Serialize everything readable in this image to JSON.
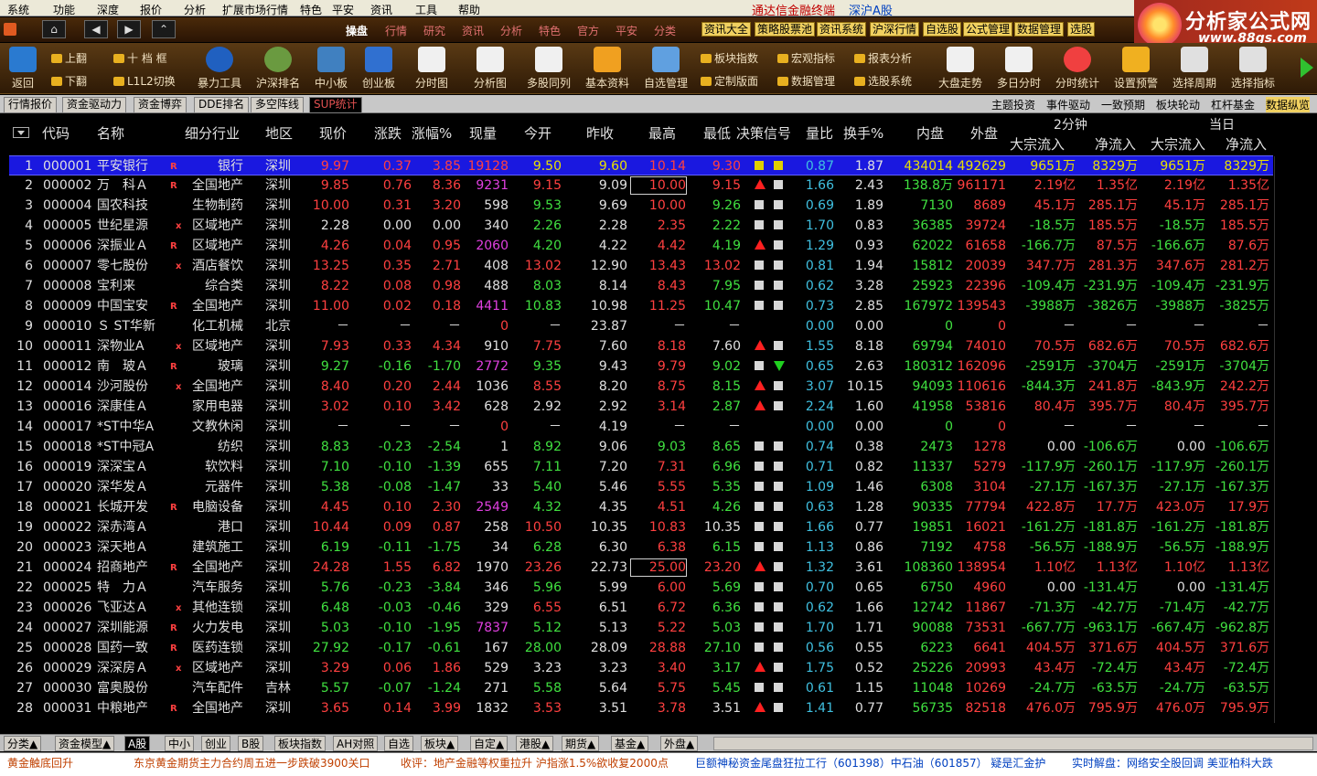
{
  "menu": [
    "系统",
    "功能",
    "深度",
    "报价",
    "分析",
    "扩展市场行情",
    "特色",
    "平安",
    "资讯",
    "工具",
    "帮助"
  ],
  "app_title": "通达信金融终端",
  "app_subtitle": "深沪A股",
  "logo": {
    "name": "分析家公式网",
    "url": "www.88gs.com"
  },
  "nav": {
    "back": "◀",
    "forward": "▶",
    "up": "⌃",
    "home": "⌂"
  },
  "tabs2": [
    "操盘",
    "行情",
    "研究",
    "资讯",
    "分析",
    "特色",
    "官方",
    "平安",
    "分类"
  ],
  "yellow_btns": [
    "资讯大全",
    "策略股票池",
    "资讯系统",
    "沪深行情",
    "自选股",
    "公式管理",
    "数据管理",
    "选股"
  ],
  "toolbar": {
    "back": "返回",
    "up": "上翻",
    "down": "下翻",
    "f10": "十 档 框",
    "l1l2": "L1L2切换",
    "tools": "暴力工具",
    "hs_rank": "沪深排名",
    "small": "中小板",
    "gem": "创业板",
    "timechart": "分时图",
    "analysis": "分析图",
    "multi": "多股同列",
    "basic": "基本资料",
    "custom": "自选管理",
    "sector": "板块指数",
    "macro": "宏观指标",
    "report": "报表分析",
    "layout": "定制版面",
    "datamgr": "数据管理",
    "selsys": "选股系统",
    "trend": "大盘走势",
    "multiday": "多日分时",
    "timestat": "分时统计",
    "alert": "设置预警",
    "period": "选择周期",
    "indicator": "选择指标"
  },
  "tabs": [
    "行情报价",
    "资金驱动力",
    "资金博弈",
    "DDE排名",
    "多空阵线",
    "SUP统计"
  ],
  "right_tabs": [
    "主题投资",
    "事件驱动",
    "一致预期",
    "板块轮动",
    "杠杆基金",
    "数据纵览"
  ],
  "headers": {
    "code": "代码",
    "name": "名称",
    "industry": "细分行业",
    "region": "地区",
    "price": "现价",
    "change": "涨跌",
    "pct": "涨幅%",
    "vol": "现量",
    "open": "今开",
    "prev": "昨收",
    "high": "最高",
    "low": "最低",
    "signal": "决策信号",
    "ratio": "量比",
    "turnover": "换手%",
    "inner": "内盘",
    "outer": "外盘",
    "group1": "2分钟",
    "group2": "当日",
    "bigin": "大宗流入",
    "netin": "净流入"
  },
  "rows": [
    [
      "1",
      "000001",
      "平安银行",
      "R",
      "银行",
      "深圳",
      "9.97",
      "0.37",
      "3.85",
      "19128",
      "9.50",
      "9.60",
      "10.14",
      "9.30",
      "yy",
      "0.87",
      "1.87",
      "434014",
      "492629",
      "9651万",
      "8329万",
      "9651万",
      "8329万"
    ],
    [
      "2",
      "000002",
      "万　科Ａ",
      "R",
      "全国地产",
      "深圳",
      "9.85",
      "0.76",
      "8.36",
      "9231",
      "9.15",
      "9.09",
      "10.00",
      "9.15",
      "us",
      "1.66",
      "2.43",
      "138.8万",
      "961171",
      "2.19亿",
      "1.35亿",
      "2.19亿",
      "1.35亿"
    ],
    [
      "3",
      "000004",
      "国农科技",
      "",
      "生物制药",
      "深圳",
      "10.00",
      "0.31",
      "3.20",
      "598",
      "9.53",
      "9.69",
      "10.00",
      "9.26",
      "ss",
      "0.69",
      "1.89",
      "7130",
      "8689",
      "45.1万",
      "285.1万",
      "45.1万",
      "285.1万"
    ],
    [
      "4",
      "000005",
      "世纪星源",
      "x",
      "区域地产",
      "深圳",
      "2.28",
      "0.00",
      "0.00",
      "340",
      "2.26",
      "2.28",
      "2.35",
      "2.22",
      "ss",
      "1.70",
      "0.83",
      "36385",
      "39724",
      "-18.5万",
      "185.5万",
      "-18.5万",
      "185.5万"
    ],
    [
      "5",
      "000006",
      "深振业Ａ",
      "R",
      "区域地产",
      "深圳",
      "4.26",
      "0.04",
      "0.95",
      "2060",
      "4.20",
      "4.22",
      "4.42",
      "4.19",
      "us",
      "1.29",
      "0.93",
      "62022",
      "61658",
      "-166.7万",
      "87.5万",
      "-166.6万",
      "87.6万"
    ],
    [
      "6",
      "000007",
      "零七股份",
      "x",
      "酒店餐饮",
      "深圳",
      "13.25",
      "0.35",
      "2.71",
      "408",
      "13.02",
      "12.90",
      "13.43",
      "13.02",
      "ss",
      "0.81",
      "1.94",
      "15812",
      "20039",
      "347.7万",
      "281.3万",
      "347.6万",
      "281.2万"
    ],
    [
      "7",
      "000008",
      "宝利来",
      "",
      "综合类",
      "深圳",
      "8.22",
      "0.08",
      "0.98",
      "488",
      "8.03",
      "8.14",
      "8.43",
      "7.95",
      "ss",
      "0.62",
      "3.28",
      "25923",
      "22396",
      "-109.4万",
      "-231.9万",
      "-109.4万",
      "-231.9万"
    ],
    [
      "8",
      "000009",
      "中国宝安",
      "R",
      "全国地产",
      "深圳",
      "11.00",
      "0.02",
      "0.18",
      "4411",
      "10.83",
      "10.98",
      "11.25",
      "10.47",
      "ss",
      "0.73",
      "2.85",
      "167972",
      "139543",
      "-3988万",
      "-3826万",
      "-3988万",
      "-3825万"
    ],
    [
      "9",
      "000010",
      "Ｓ ST华新",
      "",
      "化工机械",
      "北京",
      "－",
      "－",
      "－",
      "0",
      "－",
      "23.87",
      "－",
      "－",
      "",
      "0.00",
      "0.00",
      "0",
      "0",
      "－",
      "－",
      "－",
      "－"
    ],
    [
      "10",
      "000011",
      "深物业A",
      "x",
      "区域地产",
      "深圳",
      "7.93",
      "0.33",
      "4.34",
      "910",
      "7.75",
      "7.60",
      "8.18",
      "7.60",
      "us",
      "1.55",
      "8.18",
      "69794",
      "74010",
      "70.5万",
      "682.6万",
      "70.5万",
      "682.6万"
    ],
    [
      "11",
      "000012",
      "南　玻Ａ",
      "R",
      "玻璃",
      "深圳",
      "9.27",
      "-0.16",
      "-1.70",
      "2772",
      "9.35",
      "9.43",
      "9.79",
      "9.02",
      "sd",
      "0.65",
      "2.63",
      "180312",
      "162096",
      "-2591万",
      "-3704万",
      "-2591万",
      "-3704万"
    ],
    [
      "12",
      "000014",
      "沙河股份",
      "x",
      "全国地产",
      "深圳",
      "8.40",
      "0.20",
      "2.44",
      "1036",
      "8.55",
      "8.20",
      "8.75",
      "8.15",
      "us",
      "3.07",
      "10.15",
      "94093",
      "110616",
      "-844.3万",
      "241.8万",
      "-843.9万",
      "242.2万"
    ],
    [
      "13",
      "000016",
      "深康佳Ａ",
      "",
      "家用电器",
      "深圳",
      "3.02",
      "0.10",
      "3.42",
      "628",
      "2.92",
      "2.92",
      "3.14",
      "2.87",
      "us",
      "2.24",
      "1.60",
      "41958",
      "53816",
      "80.4万",
      "395.7万",
      "80.4万",
      "395.7万"
    ],
    [
      "14",
      "000017",
      "*ST中华A",
      "",
      "文教休闲",
      "深圳",
      "－",
      "－",
      "－",
      "0",
      "－",
      "4.19",
      "－",
      "－",
      "",
      "0.00",
      "0.00",
      "0",
      "0",
      "－",
      "－",
      "－",
      "－"
    ],
    [
      "15",
      "000018",
      "*ST中冠A",
      "",
      "纺织",
      "深圳",
      "8.83",
      "-0.23",
      "-2.54",
      "1",
      "8.92",
      "9.06",
      "9.03",
      "8.65",
      "ss",
      "0.74",
      "0.38",
      "2473",
      "1278",
      "0.00",
      "-106.6万",
      "0.00",
      "-106.6万"
    ],
    [
      "16",
      "000019",
      "深深宝Ａ",
      "",
      "软饮料",
      "深圳",
      "7.10",
      "-0.10",
      "-1.39",
      "655",
      "7.11",
      "7.20",
      "7.31",
      "6.96",
      "ss",
      "0.71",
      "0.82",
      "11337",
      "5279",
      "-117.9万",
      "-260.1万",
      "-117.9万",
      "-260.1万"
    ],
    [
      "17",
      "000020",
      "深华发Ａ",
      "",
      "元器件",
      "深圳",
      "5.38",
      "-0.08",
      "-1.47",
      "33",
      "5.40",
      "5.46",
      "5.55",
      "5.35",
      "ss",
      "1.09",
      "1.46",
      "6308",
      "3104",
      "-27.1万",
      "-167.3万",
      "-27.1万",
      "-167.3万"
    ],
    [
      "18",
      "000021",
      "长城开发",
      "R",
      "电脑设备",
      "深圳",
      "4.45",
      "0.10",
      "2.30",
      "2549",
      "4.32",
      "4.35",
      "4.51",
      "4.26",
      "ss",
      "0.63",
      "1.28",
      "90335",
      "77794",
      "422.8万",
      "17.7万",
      "423.0万",
      "17.9万"
    ],
    [
      "19",
      "000022",
      "深赤湾Ａ",
      "",
      "港口",
      "深圳",
      "10.44",
      "0.09",
      "0.87",
      "258",
      "10.50",
      "10.35",
      "10.83",
      "10.35",
      "ss",
      "1.66",
      "0.77",
      "19851",
      "16021",
      "-161.2万",
      "-181.8万",
      "-161.2万",
      "-181.8万"
    ],
    [
      "20",
      "000023",
      "深天地Ａ",
      "",
      "建筑施工",
      "深圳",
      "6.19",
      "-0.11",
      "-1.75",
      "34",
      "6.28",
      "6.30",
      "6.38",
      "6.15",
      "ss",
      "1.13",
      "0.86",
      "7192",
      "4758",
      "-56.5万",
      "-188.9万",
      "-56.5万",
      "-188.9万"
    ],
    [
      "21",
      "000024",
      "招商地产",
      "R",
      "全国地产",
      "深圳",
      "24.28",
      "1.55",
      "6.82",
      "1970",
      "23.26",
      "22.73",
      "25.00",
      "23.20",
      "us",
      "1.32",
      "3.61",
      "108360",
      "138954",
      "1.10亿",
      "1.13亿",
      "1.10亿",
      "1.13亿"
    ],
    [
      "22",
      "000025",
      "特　力Ａ",
      "",
      "汽车服务",
      "深圳",
      "5.76",
      "-0.23",
      "-3.84",
      "346",
      "5.96",
      "5.99",
      "6.00",
      "5.69",
      "ss",
      "0.70",
      "0.65",
      "6750",
      "4960",
      "0.00",
      "-131.4万",
      "0.00",
      "-131.4万"
    ],
    [
      "23",
      "000026",
      "飞亚达Ａ",
      "x",
      "其他连锁",
      "深圳",
      "6.48",
      "-0.03",
      "-0.46",
      "329",
      "6.55",
      "6.51",
      "6.72",
      "6.36",
      "ss",
      "0.62",
      "1.66",
      "12742",
      "11867",
      "-71.3万",
      "-42.7万",
      "-71.4万",
      "-42.7万"
    ],
    [
      "24",
      "000027",
      "深圳能源",
      "R",
      "火力发电",
      "深圳",
      "5.03",
      "-0.10",
      "-1.95",
      "7837",
      "5.12",
      "5.13",
      "5.22",
      "5.03",
      "ss",
      "1.70",
      "1.71",
      "90088",
      "73531",
      "-667.7万",
      "-963.1万",
      "-667.4万",
      "-962.8万"
    ],
    [
      "25",
      "000028",
      "国药一致",
      "R",
      "医药连锁",
      "深圳",
      "27.92",
      "-0.17",
      "-0.61",
      "167",
      "28.00",
      "28.09",
      "28.88",
      "27.10",
      "ss",
      "0.56",
      "0.55",
      "6223",
      "6641",
      "404.5万",
      "371.6万",
      "404.5万",
      "371.6万"
    ],
    [
      "26",
      "000029",
      "深深房Ａ",
      "x",
      "区域地产",
      "深圳",
      "3.29",
      "0.06",
      "1.86",
      "529",
      "3.23",
      "3.23",
      "3.40",
      "3.17",
      "us",
      "1.75",
      "0.52",
      "25226",
      "20993",
      "43.4万",
      "-72.4万",
      "43.4万",
      "-72.4万"
    ],
    [
      "27",
      "000030",
      "富奥股份",
      "",
      "汽车配件",
      "吉林",
      "5.57",
      "-0.07",
      "-1.24",
      "271",
      "5.58",
      "5.64",
      "5.75",
      "5.45",
      "ss",
      "0.61",
      "1.15",
      "11048",
      "10269",
      "-24.7万",
      "-63.5万",
      "-24.7万",
      "-63.5万"
    ],
    [
      "28",
      "000031",
      "中粮地产",
      "R",
      "全国地产",
      "深圳",
      "3.65",
      "0.14",
      "3.99",
      "1832",
      "3.53",
      "3.51",
      "3.78",
      "3.51",
      "us",
      "1.41",
      "0.77",
      "56735",
      "82518",
      "476.0万",
      "795.9万",
      "476.0万",
      "795.9万"
    ]
  ],
  "bottom_tabs": [
    "分类▲",
    "资金模型▲",
    "A股",
    "中小",
    "创业",
    "B股",
    "板块指数",
    "AH对照",
    "自选",
    "板块▲",
    "自定▲",
    "港股▲",
    "期货▲",
    "基金▲",
    "外盘▲"
  ],
  "ticker": [
    "黄金触底回升",
    "东京黄金期货主力合约周五进一步跌破3900关口",
    "收评：地产金融等权重拉升 沪指涨1.5%欲收复2000点",
    "巨额神秘资金尾盘狂拉工行（601398）中石油（601857） 疑是汇金护",
    "实时解盘：网络安全股回调 美亚柏科大跌"
  ],
  "colors": {
    "selected_row": "#1a18e0",
    "up": "#ff4040",
    "down": "#40e040",
    "background": "#000000"
  }
}
